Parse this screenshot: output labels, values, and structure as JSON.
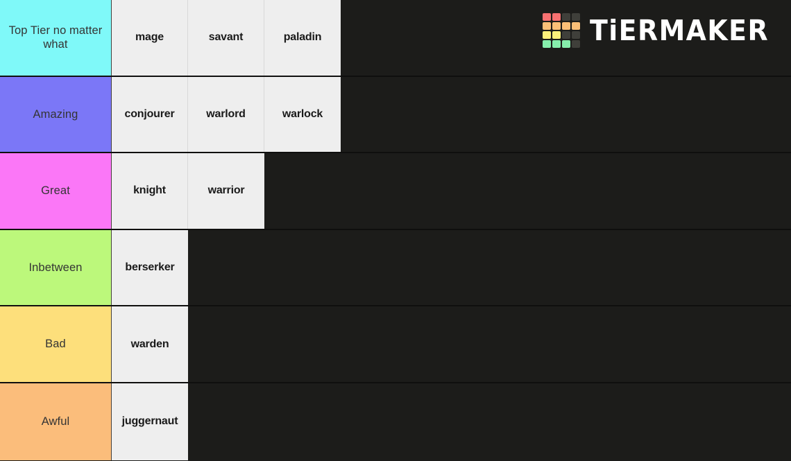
{
  "logo": {
    "brand_text": "TiERMAKER",
    "grid_colors": [
      [
        "#f87171",
        "#f87171",
        "#3f3f3a",
        "#3f3f3a"
      ],
      [
        "#fbbf77",
        "#fbbf77",
        "#fbbf77",
        "#fbbf77"
      ],
      [
        "#fdf07a",
        "#fdf07a",
        "#3f3f3a",
        "#3f3f3a"
      ],
      [
        "#86efac",
        "#86efac",
        "#86efac",
        "#3f3f3a"
      ]
    ]
  },
  "theme": {
    "background": "#1c1c1a",
    "tile_background": "#eeeeee",
    "tile_text": "#1a1a1a",
    "label_text": "#343434"
  },
  "tiers": [
    {
      "label": "Top Tier no matter what",
      "color": "#7ff9f9",
      "items": [
        "mage",
        "savant",
        "paladin"
      ]
    },
    {
      "label": "Amazing",
      "color": "#7b77f7",
      "items": [
        "conjourer",
        "warlord",
        "warlock"
      ]
    },
    {
      "label": "Great",
      "color": "#fb77f7",
      "items": [
        "knight",
        "warrior"
      ]
    },
    {
      "label": "Inbetween",
      "color": "#bcf87b",
      "items": [
        "berserker"
      ]
    },
    {
      "label": "Bad",
      "color": "#fddf7b",
      "items": [
        "warden"
      ]
    },
    {
      "label": "Awful",
      "color": "#fbbd7b",
      "items": [
        "juggernaut"
      ]
    }
  ]
}
